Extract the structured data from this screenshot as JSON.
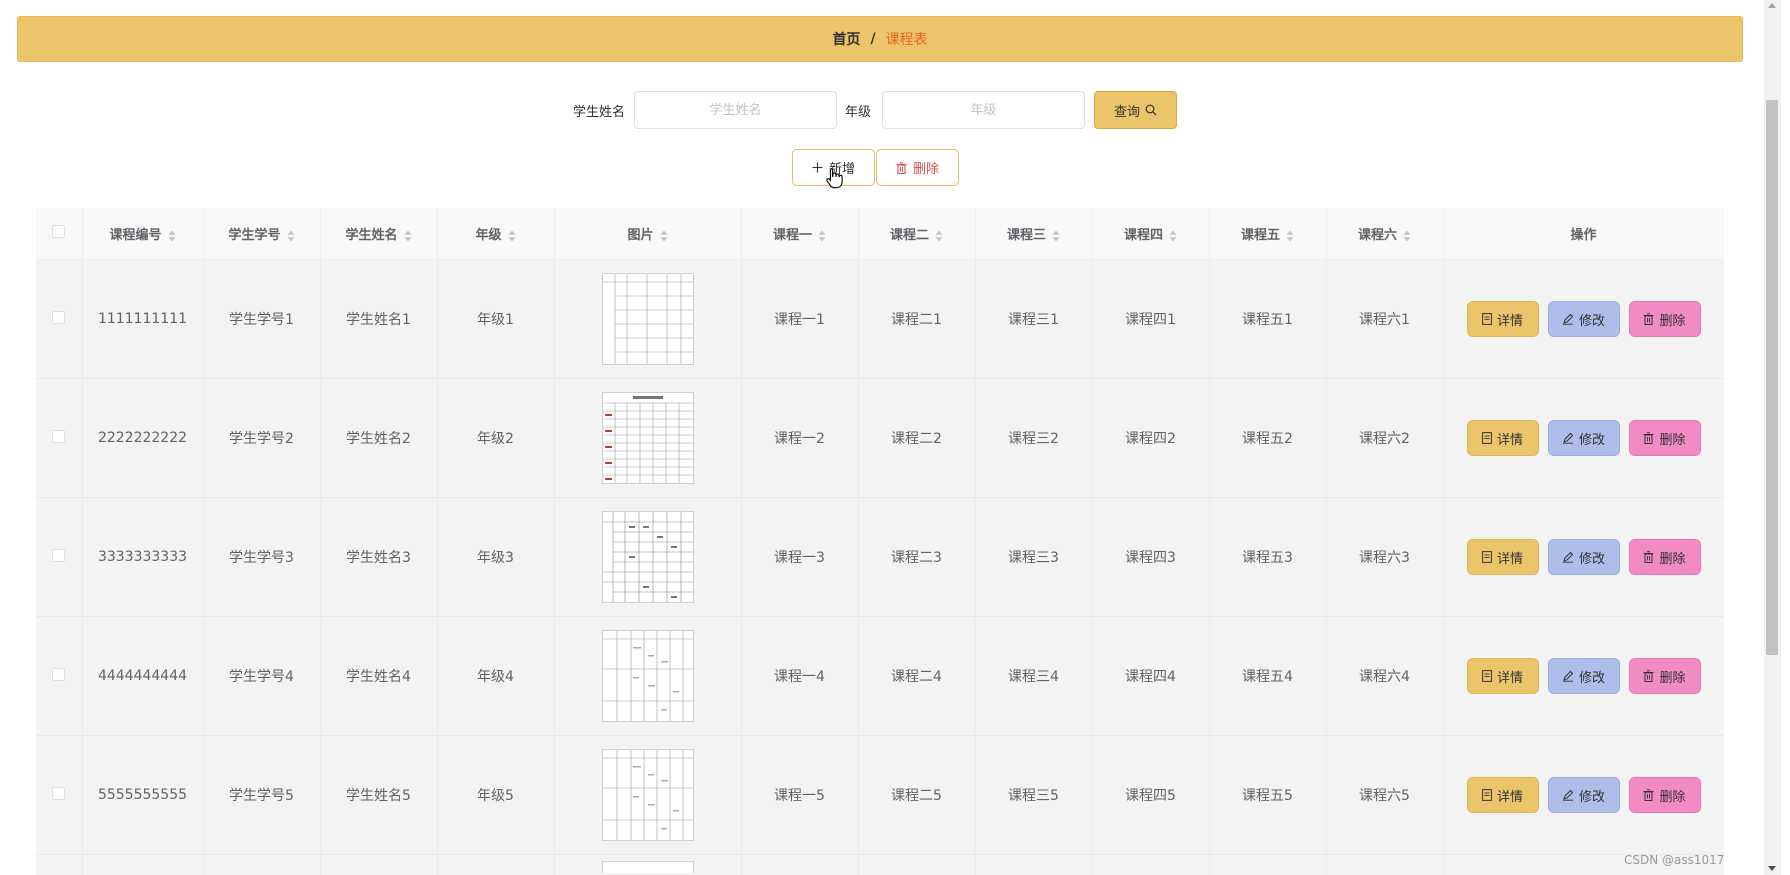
{
  "breadcrumb": {
    "home": "首页",
    "separator": "/",
    "current": "课程表"
  },
  "search": {
    "name_label": "学生姓名",
    "name_placeholder": "学生姓名",
    "grade_label": "年级",
    "grade_placeholder": "年级",
    "query_label": "查询"
  },
  "toolbar": {
    "add_label": "新增",
    "delete_label": "删除"
  },
  "table": {
    "columns": [
      "课程编号",
      "学生学号",
      "学生姓名",
      "年级",
      "图片",
      "课程一",
      "课程二",
      "课程三",
      "课程四",
      "课程五",
      "课程六"
    ],
    "ops_header": "操作",
    "rows": [
      {
        "id": "1111111111",
        "student_no": "学生学号1",
        "student_name": "学生姓名1",
        "grade": "年级1",
        "c1": "课程一1",
        "c2": "课程二1",
        "c3": "课程三1",
        "c4": "课程四1",
        "c5": "课程五1",
        "c6": "课程六1"
      },
      {
        "id": "2222222222",
        "student_no": "学生学号2",
        "student_name": "学生姓名2",
        "grade": "年级2",
        "c1": "课程一2",
        "c2": "课程二2",
        "c3": "课程三2",
        "c4": "课程四2",
        "c5": "课程五2",
        "c6": "课程六2"
      },
      {
        "id": "3333333333",
        "student_no": "学生学号3",
        "student_name": "学生姓名3",
        "grade": "年级3",
        "c1": "课程一3",
        "c2": "课程二3",
        "c3": "课程三3",
        "c4": "课程四3",
        "c5": "课程五3",
        "c6": "课程六3"
      },
      {
        "id": "4444444444",
        "student_no": "学生学号4",
        "student_name": "学生姓名4",
        "grade": "年级4",
        "c1": "课程一4",
        "c2": "课程二4",
        "c3": "课程三4",
        "c4": "课程四4",
        "c5": "课程五4",
        "c6": "课程六4"
      },
      {
        "id": "5555555555",
        "student_no": "学生学号5",
        "student_name": "学生姓名5",
        "grade": "年级5",
        "c1": "课程一5",
        "c2": "课程二5",
        "c3": "课程三5",
        "c4": "课程四5",
        "c5": "课程五5",
        "c6": "课程六5"
      }
    ],
    "row_actions": {
      "detail": "详情",
      "edit": "修改",
      "delete": "删除"
    }
  },
  "watermark": "CSDN @ass1017",
  "colors": {
    "accent": "#ecc56b",
    "edit": "#aebde9",
    "delete": "#f28bc3",
    "breadcrumb_current": "#e8651b"
  }
}
